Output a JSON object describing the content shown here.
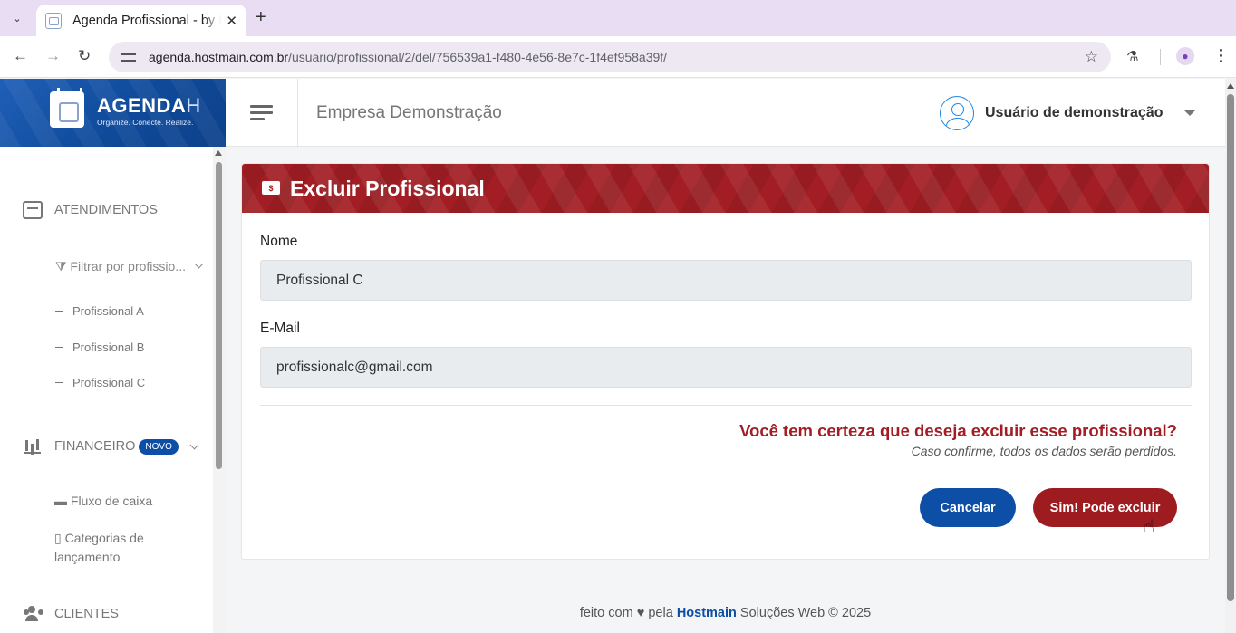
{
  "browser": {
    "tab_title": "Agenda Profissional - by Hostmain",
    "url_host": "agenda.hostmain.com.br",
    "url_path": "/usuario/profissional/2/del/756539a1-f480-4e56-8e7c-1f4ef958a39f/",
    "new_tab": "+",
    "close": "✕"
  },
  "logo": {
    "name": "AGENDA",
    "name_suffix": "H",
    "tagline": "Organize. Conecte. Realize."
  },
  "topbar": {
    "company": "Empresa Demonstração",
    "user": "Usuário de demonstração"
  },
  "sidebar": {
    "atendimentos": "ATENDIMENTOS",
    "filter": "Filtrar por profissio...",
    "professionals": [
      "Profissional A",
      "Profissional B",
      "Profissional C"
    ],
    "financeiro": "FINANCEIRO",
    "financeiro_badge": "NOVO",
    "fluxo": "Fluxo de caixa",
    "categorias": "Categorias de lançamento",
    "clientes": "CLIENTES"
  },
  "card": {
    "title": "Excluir Profissional",
    "money_symbol": "$",
    "name_label": "Nome",
    "name_value": "Profissional C",
    "email_label": "E-Mail",
    "email_value": "profissionalc@gmail.com",
    "question": "Você tem certeza que deseja excluir esse profissional?",
    "warning": "Caso confirme, todos os dados serão perdidos.",
    "cancel_label": "Cancelar",
    "confirm_label": "Sim! Pode excluir"
  },
  "footer": {
    "prefix": "feito com",
    "heart": "♥",
    "pela": "pela",
    "brand": "Hostmain",
    "suffix": "Soluções Web © 2025"
  },
  "colors": {
    "primary_blue": "#0d4ea6",
    "danger_red": "#a31e24"
  }
}
